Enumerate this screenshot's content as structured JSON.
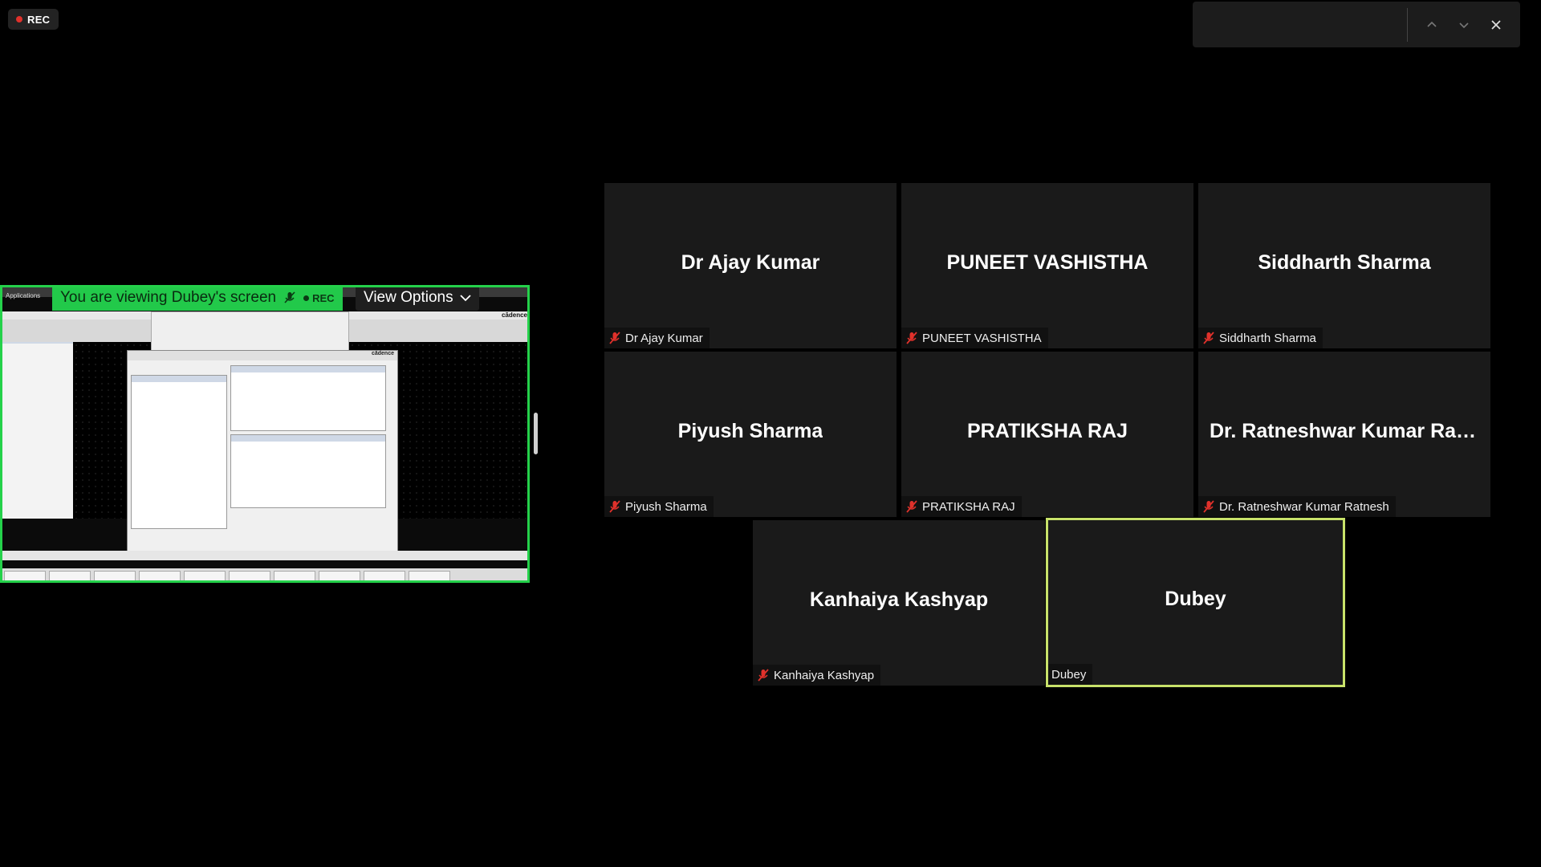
{
  "recording": {
    "label": "REC",
    "dot_color": "#e0312b"
  },
  "search": {
    "value": ""
  },
  "share": {
    "banner_text": "You are viewing Dubey's screen",
    "banner_rec": "REC",
    "view_options_label": "View Options",
    "border_color": "#24d14a",
    "screen_logo": "cādence",
    "window_logo": "cādence",
    "app_menu": "Applications"
  },
  "participants": [
    {
      "name": "Dr Ajay Kumar",
      "label": "Dr Ajay Kumar",
      "muted": true
    },
    {
      "name": "PUNEET VASHISTHA",
      "label": "PUNEET VASHISTHA",
      "muted": true
    },
    {
      "name": "Siddharth Sharma",
      "label": "Siddharth Sharma",
      "muted": true
    },
    {
      "name": "Piyush Sharma",
      "label": "Piyush Sharma",
      "muted": true
    },
    {
      "name": "PRATIKSHA RAJ",
      "label": "PRATIKSHA RAJ",
      "muted": true
    },
    {
      "name": "Dr. Ratneshwar Kumar Ratnesh",
      "label": "Dr. Ratneshwar Kumar Ratnesh",
      "muted": true
    },
    {
      "name": "Kanhaiya Kashyap",
      "label": "Kanhaiya Kashyap",
      "muted": true
    },
    {
      "name": "Dubey",
      "label": "Dubey",
      "muted": false,
      "active_speaker": true
    }
  ],
  "colors": {
    "active_border": "#c8e26a",
    "mute_icon": "#e0312b",
    "tile_bg": "#1a1a1a"
  }
}
